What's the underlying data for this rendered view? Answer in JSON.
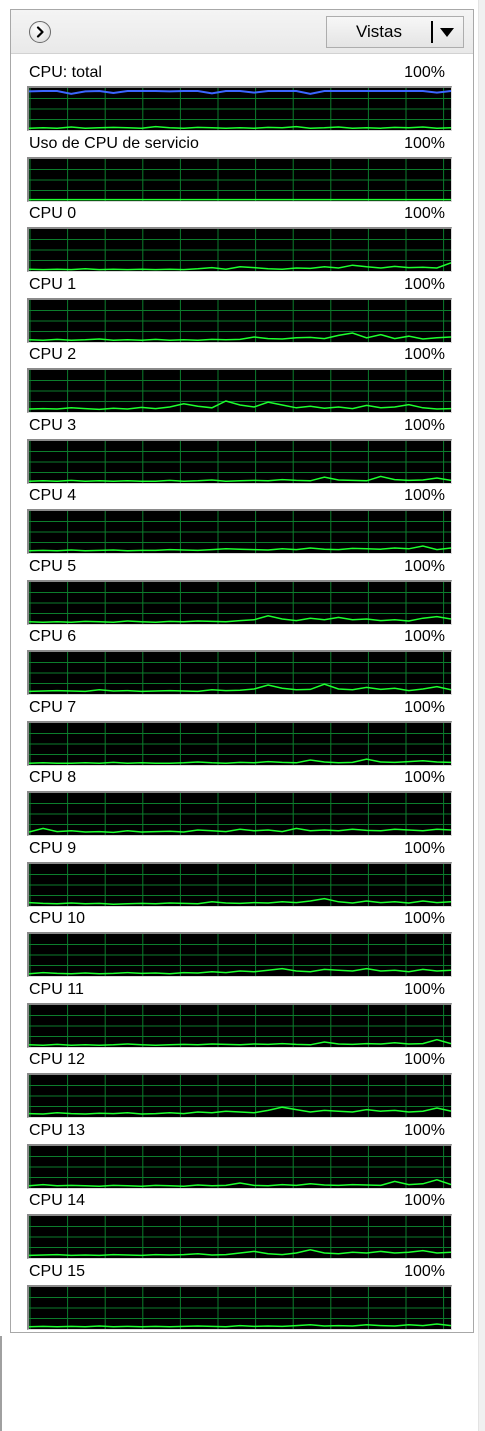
{
  "toolbar": {
    "expand_icon": "chevron-right-circle-icon",
    "views_label": "Vistas",
    "views_arrow_icon": "dropdown-arrow-icon"
  },
  "colors": {
    "graph_background": "#000000",
    "grid_line": "#0c7d2c",
    "cpu_line": "#1dff2f",
    "kernel_line": "#3b66ff"
  },
  "graphs": [
    {
      "name": "CPU: total",
      "max": "100%",
      "series": {
        "cpu": [
          2,
          3,
          2,
          5,
          2,
          3,
          4,
          3,
          2,
          6,
          3,
          2,
          4,
          3,
          2,
          3,
          2,
          4,
          3,
          6,
          2,
          3,
          5,
          2,
          3,
          2,
          4,
          3,
          5,
          2,
          3
        ],
        "kernel": [
          94,
          95,
          95,
          88,
          94,
          95,
          90,
          95,
          95,
          95,
          94,
          95,
          95,
          89,
          95,
          95,
          91,
          95,
          95,
          95,
          88,
          95,
          95,
          95,
          95,
          95,
          95,
          95,
          95,
          91,
          95
        ]
      }
    },
    {
      "name": "Uso de CPU de servicio",
      "max": "100%",
      "series": {
        "cpu": [
          1,
          1,
          1,
          1,
          1,
          1,
          1,
          1,
          1,
          1,
          1,
          1,
          1,
          1,
          1,
          1,
          1,
          1,
          1,
          1,
          1,
          1,
          1,
          1,
          1,
          1,
          1,
          1,
          1,
          1,
          1
        ]
      }
    },
    {
      "name": "CPU 0",
      "max": "100%",
      "series": {
        "cpu": [
          2,
          1,
          2,
          1,
          3,
          1,
          2,
          1,
          2,
          1,
          2,
          1,
          3,
          6,
          2,
          8,
          6,
          3,
          2,
          5,
          4,
          8,
          5,
          12,
          8,
          5,
          9,
          6,
          7,
          5,
          18
        ]
      }
    },
    {
      "name": "CPU 1",
      "max": "100%",
      "series": {
        "cpu": [
          3,
          2,
          4,
          2,
          3,
          5,
          2,
          3,
          2,
          4,
          2,
          3,
          2,
          4,
          3,
          4,
          10,
          6,
          5,
          8,
          9,
          6,
          14,
          20,
          8,
          16,
          6,
          12,
          5,
          8,
          10
        ]
      }
    },
    {
      "name": "CPU 2",
      "max": "100%",
      "series": {
        "cpu": [
          5,
          6,
          5,
          8,
          6,
          4,
          7,
          5,
          9,
          6,
          10,
          18,
          12,
          8,
          25,
          15,
          10,
          22,
          15,
          8,
          12,
          7,
          10,
          6,
          14,
          8,
          10,
          16,
          8,
          5,
          6
        ]
      }
    },
    {
      "name": "CPU 3",
      "max": "100%",
      "series": {
        "cpu": [
          2,
          3,
          2,
          4,
          2,
          3,
          2,
          3,
          2,
          2,
          4,
          2,
          3,
          5,
          2,
          3,
          4,
          3,
          6,
          4,
          3,
          12,
          5,
          4,
          3,
          14,
          6,
          4,
          5,
          10,
          4
        ]
      }
    },
    {
      "name": "CPU 4",
      "max": "100%",
      "series": {
        "cpu": [
          3,
          4,
          3,
          5,
          3,
          4,
          5,
          3,
          4,
          4,
          6,
          5,
          4,
          6,
          8,
          7,
          6,
          5,
          8,
          6,
          10,
          7,
          6,
          9,
          8,
          7,
          10,
          8,
          15,
          6,
          10
        ]
      }
    },
    {
      "name": "CPU 5",
      "max": "100%",
      "series": {
        "cpu": [
          3,
          2,
          3,
          2,
          4,
          3,
          2,
          5,
          3,
          2,
          4,
          3,
          5,
          4,
          3,
          6,
          8,
          18,
          10,
          6,
          12,
          8,
          14,
          8,
          10,
          6,
          8,
          5,
          12,
          16,
          10
        ]
      }
    },
    {
      "name": "CPU 6",
      "max": "100%",
      "series": {
        "cpu": [
          4,
          5,
          6,
          5,
          4,
          8,
          5,
          6,
          4,
          5,
          6,
          5,
          4,
          8,
          6,
          7,
          10,
          20,
          12,
          8,
          9,
          22,
          10,
          8,
          14,
          9,
          12,
          6,
          10,
          16,
          8
        ]
      }
    },
    {
      "name": "CPU 7",
      "max": "100%",
      "series": {
        "cpu": [
          2,
          3,
          2,
          2,
          3,
          2,
          4,
          2,
          3,
          2,
          2,
          3,
          5,
          3,
          2,
          4,
          3,
          6,
          4,
          3,
          10,
          5,
          3,
          4,
          12,
          5,
          4,
          6,
          8,
          5,
          4
        ]
      }
    },
    {
      "name": "CPU 8",
      "max": "100%",
      "series": {
        "cpu": [
          5,
          14,
          6,
          8,
          5,
          6,
          4,
          8,
          5,
          6,
          7,
          5,
          10,
          8,
          6,
          12,
          8,
          10,
          6,
          14,
          8,
          10,
          8,
          12,
          9,
          8,
          12,
          10,
          8,
          12,
          10
        ]
      }
    },
    {
      "name": "CPU 9",
      "max": "100%",
      "series": {
        "cpu": [
          6,
          4,
          3,
          5,
          3,
          4,
          2,
          3,
          4,
          3,
          5,
          4,
          3,
          8,
          5,
          4,
          6,
          5,
          8,
          6,
          10,
          16,
          8,
          5,
          10,
          6,
          8,
          5,
          10,
          6,
          8
        ]
      }
    },
    {
      "name": "CPU 10",
      "max": "100%",
      "series": {
        "cpu": [
          3,
          6,
          4,
          3,
          5,
          3,
          4,
          6,
          4,
          5,
          3,
          6,
          5,
          8,
          6,
          10,
          8,
          12,
          16,
          10,
          8,
          14,
          12,
          10,
          16,
          10,
          12,
          8,
          14,
          10,
          12
        ]
      }
    },
    {
      "name": "CPU 11",
      "max": "100%",
      "series": {
        "cpu": [
          3,
          2,
          4,
          2,
          3,
          2,
          3,
          5,
          3,
          2,
          3,
          4,
          3,
          5,
          4,
          3,
          5,
          4,
          6,
          4,
          3,
          10,
          5,
          4,
          6,
          5,
          8,
          5,
          6,
          16,
          6
        ]
      }
    },
    {
      "name": "CPU 12",
      "max": "100%",
      "series": {
        "cpu": [
          6,
          5,
          8,
          6,
          5,
          7,
          6,
          8,
          5,
          6,
          8,
          6,
          10,
          8,
          12,
          10,
          8,
          14,
          22,
          16,
          10,
          14,
          12,
          10,
          16,
          12,
          14,
          10,
          12,
          20,
          12
        ]
      }
    },
    {
      "name": "CPU 13",
      "max": "100%",
      "series": {
        "cpu": [
          3,
          6,
          3,
          4,
          3,
          2,
          4,
          3,
          2,
          4,
          3,
          2,
          5,
          3,
          4,
          10,
          4,
          3,
          6,
          4,
          8,
          5,
          4,
          6,
          5,
          4,
          14,
          6,
          8,
          18,
          6
        ]
      }
    },
    {
      "name": "CPU 14",
      "max": "100%",
      "series": {
        "cpu": [
          4,
          5,
          6,
          4,
          5,
          4,
          6,
          5,
          4,
          6,
          5,
          6,
          8,
          5,
          6,
          10,
          14,
          8,
          6,
          10,
          18,
          10,
          8,
          12,
          10,
          14,
          10,
          12,
          16,
          10,
          12
        ]
      }
    },
    {
      "name": "CPU 15",
      "max": "100%",
      "series": {
        "cpu": [
          3,
          4,
          3,
          4,
          3,
          5,
          3,
          4,
          3,
          4,
          3,
          4,
          5,
          4,
          3,
          6,
          4,
          5,
          4,
          6,
          8,
          5,
          6,
          5,
          8,
          6,
          5,
          8,
          6,
          10,
          6
        ]
      }
    }
  ]
}
